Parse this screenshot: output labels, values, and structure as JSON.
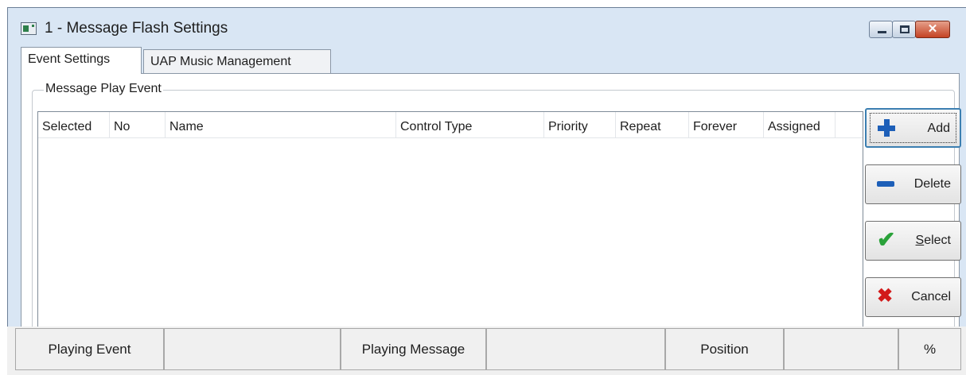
{
  "window": {
    "title": "1 - Message Flash Settings",
    "icon": "app-window-icon",
    "controls": {
      "minimize": "minimize-icon",
      "maximize": "maximize-icon",
      "close_glyph": "✕"
    }
  },
  "tabs": [
    {
      "label": "Event Settings",
      "active": true
    },
    {
      "label": "UAP Music Management",
      "active": false
    }
  ],
  "group": {
    "label": "Message Play Event"
  },
  "table": {
    "columns": [
      "Selected",
      "No",
      "Name",
      "Control Type",
      "Priority",
      "Repeat",
      "Forever",
      "Assigned"
    ],
    "rows": []
  },
  "buttons": {
    "add": "Add",
    "delete": "Delete",
    "select": "Select",
    "select_mnemonic": "S",
    "select_rest": "elect",
    "cancel": "Cancel"
  },
  "status": {
    "playing_event_label": "Playing Event",
    "playing_event_value": "",
    "playing_message_label": "Playing Message",
    "playing_message_value": "",
    "position_label": "Position",
    "position_value": "",
    "percent": "%"
  },
  "colors": {
    "accent": "#1d5fb8",
    "check": "#2aa23a",
    "cancel": "#d21a1a",
    "titlebar": "#d9e6f4",
    "close": "#c44324"
  }
}
